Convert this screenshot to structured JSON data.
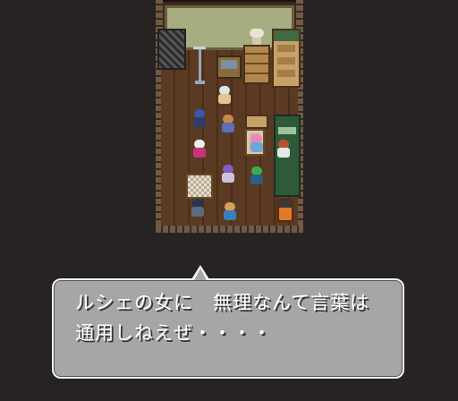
{
  "dialog": {
    "line1": "ルシェの女に　無理なんて言葉は",
    "line2": "通用しねえぜ・・・・"
  },
  "colors": {
    "background": "#262322",
    "dialog_fill": "#a6a6a6",
    "dialog_border": "#f2f2f2",
    "dialog_text": "#ffffff"
  }
}
